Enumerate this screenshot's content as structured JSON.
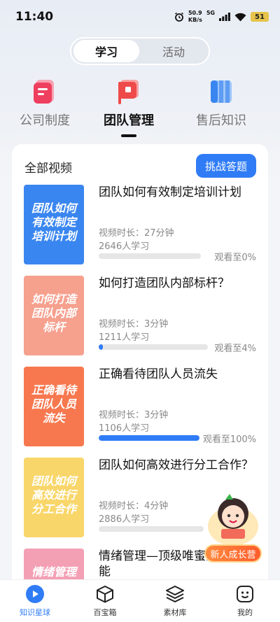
{
  "status_bar": {
    "time": "11:40",
    "net_speed_value": "50.9",
    "net_speed_unit": "KB/s",
    "network": "5G",
    "battery": "51"
  },
  "tabs": [
    {
      "label": "学习",
      "active": true
    },
    {
      "label": "活动",
      "active": false
    }
  ],
  "categories": [
    {
      "label": "公司制度",
      "icon": "document-icon",
      "active": false
    },
    {
      "label": "团队管理",
      "icon": "flag-icon",
      "active": true
    },
    {
      "label": "售后知识",
      "icon": "book-icon",
      "active": false
    }
  ],
  "video_list": {
    "title": "全部视频",
    "challenge_label": "挑战答题",
    "items": [
      {
        "thumb_text": "团队如何有效制定培训计划",
        "title": "团队如何有效制定培训计划",
        "duration": "视频时长：27分钟",
        "learners": "2646人学习",
        "progress_label": "观看至0%",
        "progress": 0,
        "thumb_color": "#3a86f0"
      },
      {
        "thumb_text": "如何打造团队内部标杆",
        "title": "如何打造团队内部标杆？",
        "duration": "视频时长：3分钟",
        "learners": "1211人学习",
        "progress_label": "观看至4%",
        "progress": 4,
        "thumb_color": "#f6a08e"
      },
      {
        "thumb_text": "正确看待团队人员流失",
        "title": "正确看待团队人员流失",
        "duration": "视频时长：3分钟",
        "learners": "1106人学习",
        "progress_label": "观看至100%",
        "progress": 100,
        "thumb_color": "#f7784f"
      },
      {
        "thumb_text": "团队如何高效进行分工合作",
        "title": "团队如何高效进行分工合作？",
        "duration": "视频时长：4分钟",
        "learners": "2886人学习",
        "progress_label": "",
        "progress": 0,
        "thumb_color": "#f9d66a"
      },
      {
        "thumb_text": "情绪管理",
        "title": "情绪管理—顶级唯蜜的必备技能",
        "duration": "",
        "learners": "",
        "progress_label": "",
        "progress": 0,
        "thumb_color": "#f4a0b4"
      }
    ]
  },
  "growth_camp": {
    "label": "新人成长营"
  },
  "bottom_nav": [
    {
      "label": "知识星球",
      "icon": "play-circle-icon",
      "active": true
    },
    {
      "label": "百宝箱",
      "icon": "box-icon",
      "active": false
    },
    {
      "label": "素材库",
      "icon": "layers-icon",
      "active": false
    },
    {
      "label": "我的",
      "icon": "smiley-icon",
      "active": false
    }
  ],
  "colors": {
    "accent": "#2f7cf6",
    "progress_track": "#e6e6e6"
  }
}
